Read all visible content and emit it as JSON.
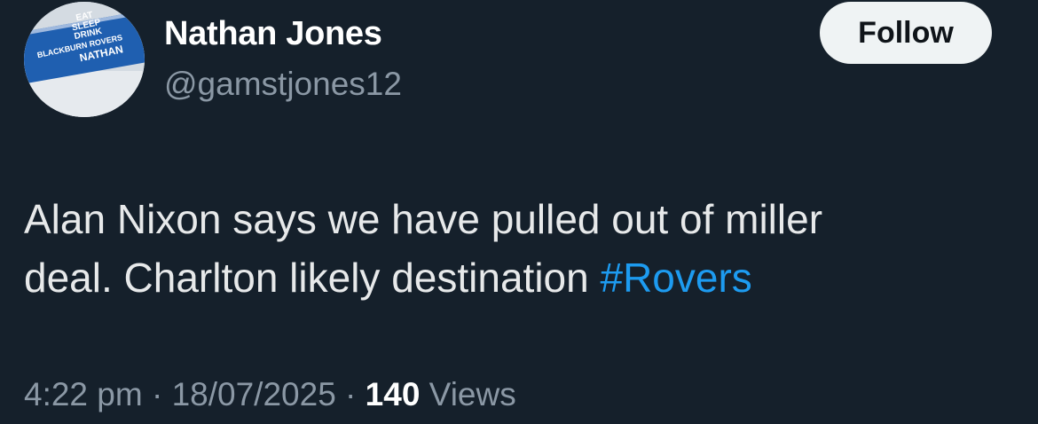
{
  "author": {
    "name": "Nathan Jones",
    "handle": "@gamstjones12",
    "avatar_sign_lines": [
      "EAT",
      "SLEEP",
      "DRINK",
      "BLACKBURN ROVERS",
      "NATHAN"
    ]
  },
  "follow_button": {
    "label": "Follow"
  },
  "tweet": {
    "text_line_1": "Alan Nixon says we have pulled out of miller",
    "text_line_2": "deal. Charlton likely destination ",
    "hashtag": "#Rovers"
  },
  "meta": {
    "time": "4:22 pm",
    "separator": " · ",
    "date": "18/07/2025",
    "views_count": "140",
    "views_label": " Views"
  },
  "colors": {
    "background": "#15202b",
    "hashtag": "#1d9bf0",
    "secondary_text": "#8b98a5"
  }
}
